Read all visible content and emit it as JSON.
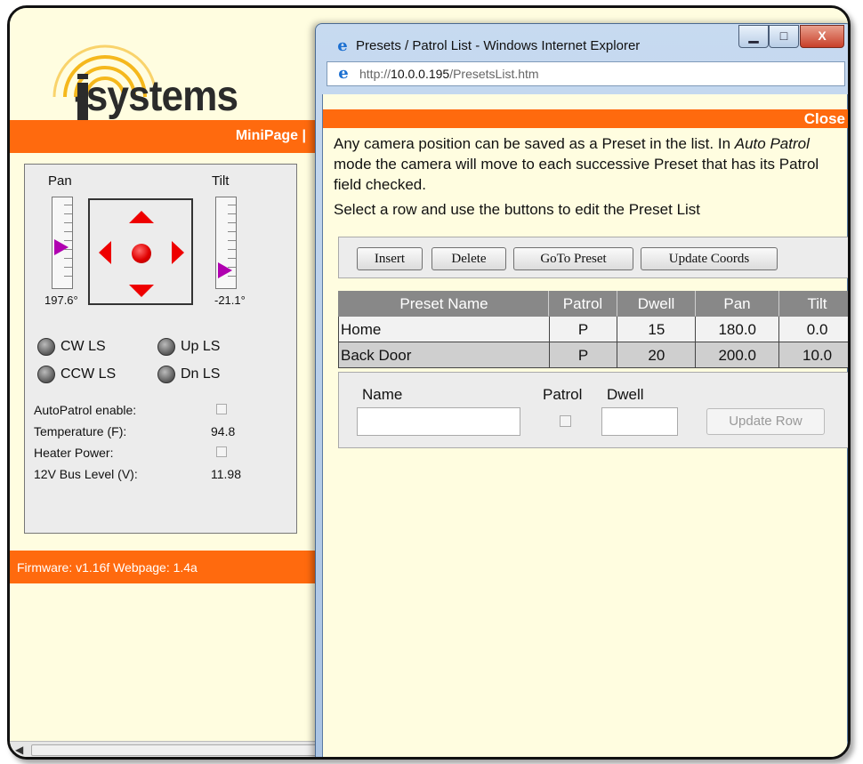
{
  "background_page": {
    "logo_text": "-systems",
    "nav_link": "MiniPage |",
    "pan_label": "Pan",
    "tilt_label": "Tilt",
    "pan_value": "197.6°",
    "tilt_value": "-21.1°",
    "pan_position": 0.55,
    "tilt_position": 0.85,
    "limit_switches": [
      "CW LS",
      "Up LS",
      "CCW LS",
      "Dn LS"
    ],
    "status": {
      "autopatrol_label": "AutoPatrol enable:",
      "temperature_label": "Temperature (F):",
      "temperature_value": "94.8",
      "heater_label": "Heater Power:",
      "bus_label": "12V Bus Level (V):",
      "bus_value": "11.98"
    },
    "footer": "Firmware: v1.16f  Webpage: 1.4a"
  },
  "popup": {
    "title": "Presets / Patrol List - Windows Internet Explorer",
    "url_prefix": "http://",
    "url_host": "10.0.0.195",
    "url_path": "/PresetsList.htm",
    "min_glyph": "▁",
    "max_glyph": "□",
    "close_glyph": "X",
    "close_label": "Close",
    "intro_part1": "Any camera position can be saved as a Preset in the list. In ",
    "intro_italic": "Auto Patrol",
    "intro_part2": " mode the camera will move to each successive Preset that has its Patrol field checked.",
    "instruction": "Select a row and use the buttons to edit the Preset List",
    "buttons": {
      "insert": "Insert",
      "delete": "Delete",
      "goto": "GoTo Preset",
      "update_coords": "Update Coords"
    },
    "table": {
      "headers": [
        "Preset Name",
        "Patrol",
        "Dwell",
        "Pan",
        "Tilt"
      ],
      "rows": [
        [
          "Home",
          "P",
          "15",
          "180.0",
          "0.0"
        ],
        [
          "Back Door",
          "P",
          "20",
          "200.0",
          "10.0"
        ]
      ]
    },
    "editor": {
      "name_label": "Name",
      "patrol_label": "Patrol",
      "dwell_label": "Dwell",
      "update_row": "Update Row"
    }
  },
  "colors": {
    "accent": "#ff6a0e",
    "page_bg": "#fffde0",
    "arrow": "#ee0000",
    "thumb": "#b000b0"
  }
}
